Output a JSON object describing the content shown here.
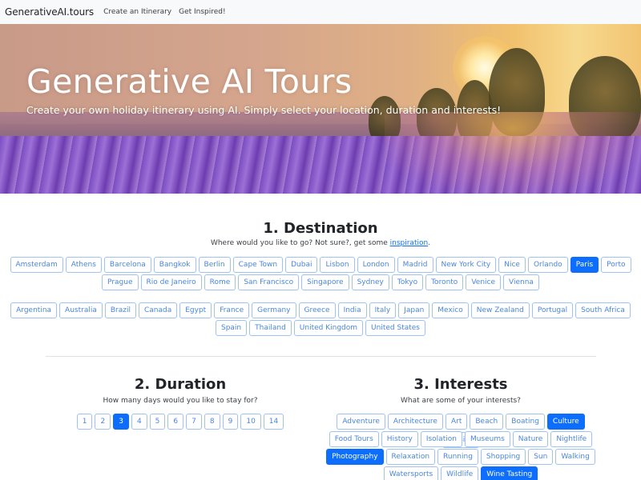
{
  "navbar": {
    "brand": "GenerativeAI.tours",
    "links": [
      "Create an Itinerary",
      "Get Inspired!"
    ]
  },
  "hero": {
    "title": "Generative AI Tours",
    "subtitle": "Create your own holiday itinerary using AI. Simply select your location, duration and interests!"
  },
  "destination": {
    "title": "1. Destination",
    "desc_prefix": "Where would you like to go? Not sure?, get some ",
    "desc_link": "inspiration",
    "desc_suffix": ".",
    "selected": "Paris",
    "cities_row1": [
      "Amsterdam",
      "Athens",
      "Barcelona",
      "Bangkok",
      "Berlin",
      "Cape Town",
      "Dubai",
      "Lisbon",
      "London",
      "Madrid",
      "New York City",
      "Nice",
      "Orlando",
      "Paris",
      "Porto"
    ],
    "cities_row2": [
      "Prague",
      "Rio de Janeiro",
      "Rome",
      "San Francisco",
      "Singapore",
      "Sydney",
      "Tokyo",
      "Toronto",
      "Venice",
      "Vienna"
    ],
    "countries_row1": [
      "Argentina",
      "Australia",
      "Brazil",
      "Canada",
      "Egypt",
      "France",
      "Germany",
      "Greece",
      "India",
      "Italy",
      "Japan",
      "Mexico",
      "New Zealand",
      "Portugal",
      "South Africa"
    ],
    "countries_row2": [
      "Spain",
      "Thailand",
      "United Kingdom",
      "United States"
    ]
  },
  "duration": {
    "title": "2. Duration",
    "desc": "How many days would you like to stay for?",
    "selected": "3",
    "options": [
      "1",
      "2",
      "3",
      "4",
      "5",
      "6",
      "7",
      "8",
      "9",
      "10",
      "14"
    ]
  },
  "interests": {
    "title": "3. Interests",
    "desc": "What are some of your interests?",
    "selected": [
      "Culture",
      "Photography",
      "Wine Tasting"
    ],
    "row1": [
      "Adventure",
      "Architecture",
      "Art",
      "Beach",
      "Boating",
      "Culture",
      "Cuisine"
    ],
    "row2": [
      "Food Tours",
      "History",
      "Isolation",
      "Museums",
      "Nature",
      "Nightlife"
    ],
    "row3": [
      "Photography",
      "Relaxation",
      "Running",
      "Shopping",
      "Sun",
      "Walking"
    ],
    "row4": [
      "Watersports",
      "Wildlife",
      "Wine Tasting"
    ]
  },
  "colors": {
    "primary": "#0d6efd",
    "outline_border": "#9ec2f2",
    "outline_text": "#4a86e0"
  }
}
